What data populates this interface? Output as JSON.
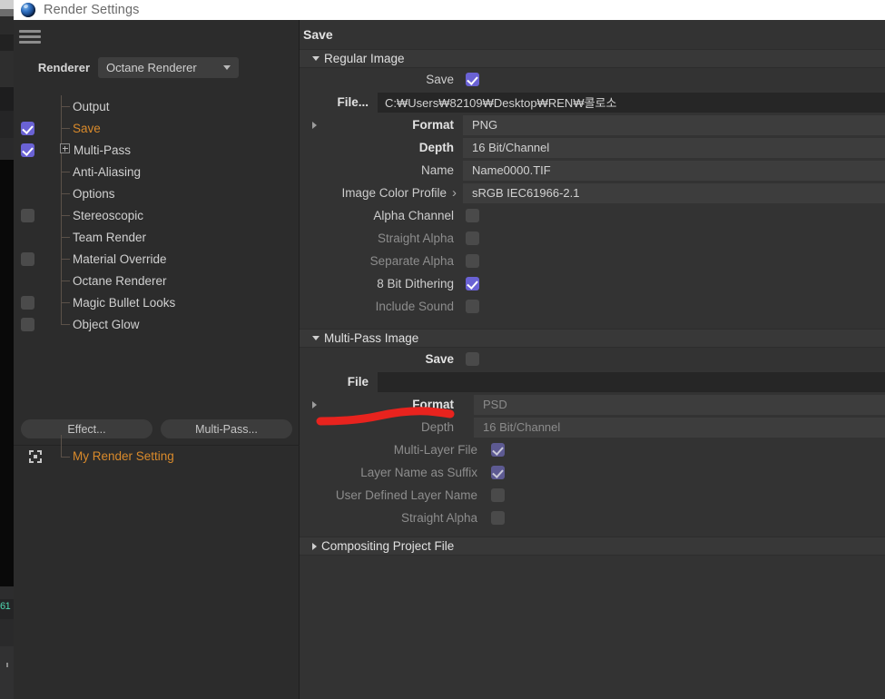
{
  "window": {
    "title": "Render Settings",
    "logo_icon": "cinema4d-logo-icon",
    "menu_icon": "hamburger-menu-icon"
  },
  "sidebar": {
    "renderer": {
      "label": "Renderer",
      "value": "Octane Renderer",
      "chevron_icon": "chevron-down-icon"
    },
    "tree": [
      {
        "label": "Output",
        "checkbox": "none",
        "selected": false,
        "expander": "none"
      },
      {
        "label": "Save",
        "checkbox": "checked",
        "selected": true,
        "expander": "none"
      },
      {
        "label": "Multi-Pass",
        "checkbox": "checked",
        "selected": false,
        "expander": "plus"
      },
      {
        "label": "Anti-Aliasing",
        "checkbox": "none",
        "selected": false,
        "expander": "none"
      },
      {
        "label": "Options",
        "checkbox": "none",
        "selected": false,
        "expander": "none"
      },
      {
        "label": "Stereoscopic",
        "checkbox": "unchecked",
        "selected": false,
        "expander": "none"
      },
      {
        "label": "Team Render",
        "checkbox": "none",
        "selected": false,
        "expander": "none"
      },
      {
        "label": "Material Override",
        "checkbox": "unchecked",
        "selected": false,
        "expander": "none"
      },
      {
        "label": "Octane Renderer",
        "checkbox": "none",
        "selected": false,
        "expander": "none"
      },
      {
        "label": "Magic Bullet Looks",
        "checkbox": "unchecked",
        "selected": false,
        "expander": "none"
      },
      {
        "label": "Object Glow",
        "checkbox": "unchecked",
        "selected": false,
        "expander": "none"
      }
    ],
    "buttons": {
      "effect": "Effect...",
      "multipass": "Multi-Pass..."
    },
    "render_setting": {
      "label": "My Render Setting",
      "icon": "render-frame-icon"
    }
  },
  "panel": {
    "title": "Save",
    "regular_image": {
      "group_label": "Regular Image",
      "expanded": true,
      "save": {
        "label": "Save",
        "checked": true
      },
      "file": {
        "label": "File...",
        "value": "C:₩Users₩82109₩Desktop₩REN₩콜로소"
      },
      "format": {
        "label": "Format",
        "value": "PNG"
      },
      "depth": {
        "label": "Depth",
        "value": "16 Bit/Channel"
      },
      "name": {
        "label": "Name",
        "value": "Name0000.TIF"
      },
      "color_profile": {
        "label": "Image Color Profile",
        "value": "sRGB IEC61966-2.1"
      },
      "alpha_channel": {
        "label": "Alpha Channel",
        "checked": false
      },
      "straight_alpha": {
        "label": "Straight Alpha",
        "checked": false
      },
      "separate_alpha": {
        "label": "Separate Alpha",
        "checked": false
      },
      "dithering": {
        "label": "8 Bit Dithering",
        "checked": true
      },
      "include_sound": {
        "label": "Include Sound",
        "checked": false
      }
    },
    "multipass_image": {
      "group_label": "Multi-Pass Image",
      "expanded": true,
      "save": {
        "label": "Save",
        "checked": false
      },
      "file": {
        "label": "File",
        "value": ""
      },
      "format": {
        "label": "Format",
        "value": "PSD"
      },
      "depth": {
        "label": "Depth",
        "value": "16 Bit/Channel"
      },
      "multi_layer_file": {
        "label": "Multi-Layer File",
        "checked": true
      },
      "layer_name_suffix": {
        "label": "Layer Name as Suffix",
        "checked": true
      },
      "user_defined_layer": {
        "label": "User Defined Layer Name",
        "checked": false
      },
      "straight_alpha": {
        "label": "Straight Alpha",
        "checked": false
      }
    },
    "compositing": {
      "group_label": "Compositing Project File",
      "expanded": false
    }
  },
  "annotation": {
    "color": "#e8231e",
    "name": "red-highlight-stroke"
  },
  "background_app": {
    "status_text": "61"
  },
  "colors": {
    "accent_orange": "#d98a2b",
    "checkbox_purple": "#6a62d4",
    "panel_bg": "#333333",
    "sidebar_bg": "#2c2c2c",
    "titlebar_bg": "#ffffff"
  }
}
